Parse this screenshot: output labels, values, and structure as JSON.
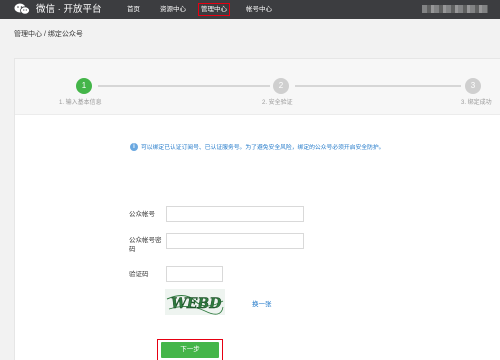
{
  "header": {
    "brand": "微信 · 开放平台",
    "nav": [
      "首页",
      "资源中心",
      "管理中心",
      "帐号中心"
    ],
    "active_nav": "管理中心"
  },
  "breadcrumb": "管理中心 / 绑定公众号",
  "steps": [
    {
      "number": "1",
      "label": "1. 输入基本信息",
      "state": "active"
    },
    {
      "number": "2",
      "label": "2. 安全验证",
      "state": "inactive"
    },
    {
      "number": "3",
      "label": "3. 绑定成功",
      "state": "inactive"
    }
  ],
  "tip": "可以绑定已认证订阅号、已认证服务号。为了避免安全风险，绑定的公众号必须开启安全防护。",
  "form": {
    "account_label": "公众帐号",
    "password_label_line1": "公众帐号密",
    "password_label_line2": "码",
    "captcha_label": "验证码",
    "captcha_text": "WEBD",
    "refresh_label": "换一张",
    "account_value": "",
    "password_value": "",
    "captcha_value": ""
  },
  "next_button": "下一步",
  "colors": {
    "topbar": "#3c3d40",
    "accent_green": "#44b549",
    "highlight_red": "#e60012",
    "link_blue": "#1e77c9"
  }
}
